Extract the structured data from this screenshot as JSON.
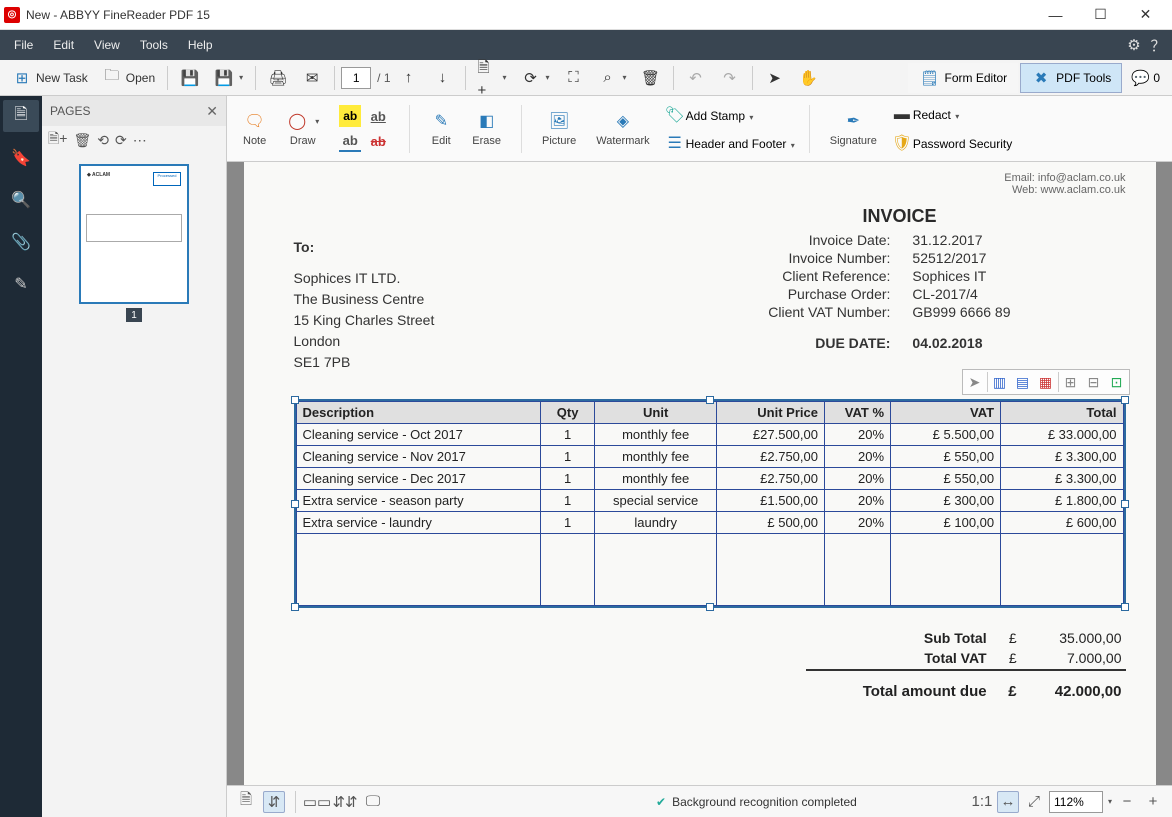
{
  "titlebar": {
    "title": "New - ABBYY FineReader PDF 15"
  },
  "menu": {
    "items": [
      "File",
      "Edit",
      "View",
      "Tools",
      "Help"
    ]
  },
  "toolbar": {
    "new_task": "New Task",
    "open": "Open",
    "page_current": "1",
    "page_total": "/ 1",
    "form_editor": "Form Editor",
    "pdf_tools": "PDF Tools",
    "comments_count": "0"
  },
  "pages_panel": {
    "title": "PAGES",
    "thumb_pagenum": "1"
  },
  "edit_toolbar": {
    "note": "Note",
    "draw": "Draw",
    "edit": "Edit",
    "erase": "Erase",
    "picture": "Picture",
    "watermark": "Watermark",
    "signature": "Signature",
    "add_stamp": "Add Stamp",
    "header_footer": "Header and Footer",
    "redact": "Redact",
    "password_security": "Password Security"
  },
  "document": {
    "contact_email": "Email: info@aclam.co.uk",
    "contact_web": "Web: www.aclam.co.uk",
    "invoice_title": "INVOICE",
    "to_label": "To:",
    "to_lines": [
      "Sophices IT LTD.",
      "The Business Centre",
      "15 King Charles Street",
      "London",
      "SE1 7PB"
    ],
    "meta": [
      {
        "label": "Invoice Date:",
        "value": "31.12.2017"
      },
      {
        "label": "Invoice Number:",
        "value": "52512/2017"
      },
      {
        "label": "Client Reference:",
        "value": "Sophices IT"
      },
      {
        "label": "Purchase Order:",
        "value": "CL-2017/4"
      },
      {
        "label": "Client VAT Number:",
        "value": "GB999 6666 89"
      }
    ],
    "due_label": "DUE DATE:",
    "due_value": "04.02.2018",
    "table_headers": [
      "Description",
      "Qty",
      "Unit",
      "Unit Price",
      "VAT %",
      "VAT",
      "Total"
    ],
    "table_rows": [
      {
        "desc": "Cleaning service - Oct 2017",
        "qty": "1",
        "unit": "monthly fee",
        "price": "£27.500,00",
        "vatp": "20%",
        "vat": "£  5.500,00",
        "total": "£   33.000,00"
      },
      {
        "desc": "Cleaning service - Nov 2017",
        "qty": "1",
        "unit": "monthly fee",
        "price": "£2.750,00",
        "vatp": "20%",
        "vat": "£     550,00",
        "total": "£     3.300,00"
      },
      {
        "desc": "Cleaning service - Dec 2017",
        "qty": "1",
        "unit": "monthly fee",
        "price": "£2.750,00",
        "vatp": "20%",
        "vat": "£     550,00",
        "total": "£     3.300,00"
      },
      {
        "desc": "Extra service - season party",
        "qty": "1",
        "unit": "special service",
        "price": "£1.500,00",
        "vatp": "20%",
        "vat": "£     300,00",
        "total": "£     1.800,00"
      },
      {
        "desc": "Extra service - laundry",
        "qty": "1",
        "unit": "laundry",
        "price": "£    500,00",
        "vatp": "20%",
        "vat": "£     100,00",
        "total": "£        600,00"
      }
    ],
    "subtotal_label": "Sub Total",
    "subtotal_cur": "£",
    "subtotal_value": "35.000,00",
    "totalvat_label": "Total VAT",
    "totalvat_cur": "£",
    "totalvat_value": "7.000,00",
    "grand_label": "Total amount due",
    "grand_cur": "£",
    "grand_value": "42.000,00"
  },
  "statusbar": {
    "recognition_text": "Background recognition completed",
    "onetoone": "1:1",
    "zoom_value": "112%"
  }
}
